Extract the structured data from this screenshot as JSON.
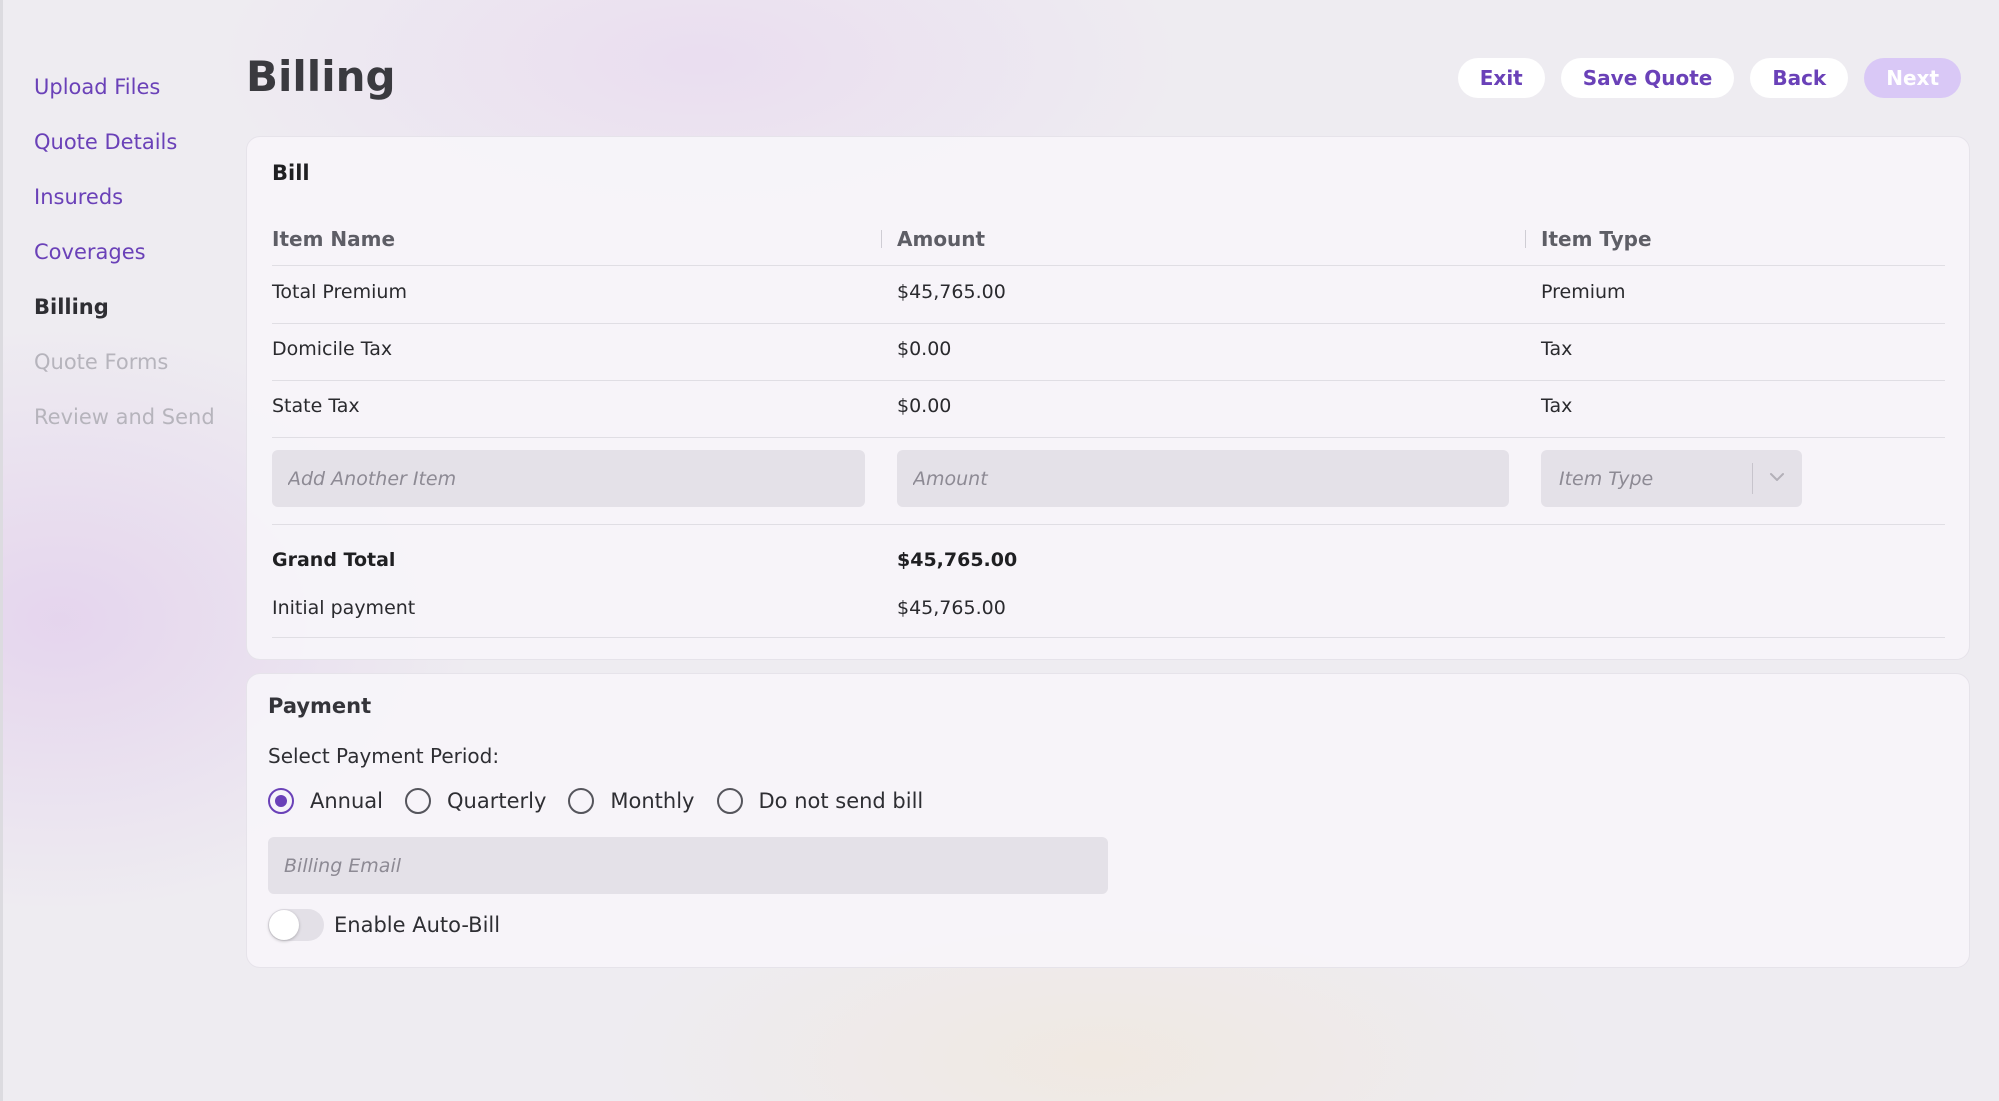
{
  "sidebar": {
    "items": [
      {
        "label": "Upload Files"
      },
      {
        "label": "Quote Details"
      },
      {
        "label": "Insureds"
      },
      {
        "label": "Coverages"
      },
      {
        "label": "Billing"
      },
      {
        "label": "Quote Forms"
      },
      {
        "label": "Review and Send"
      }
    ]
  },
  "header": {
    "title": "Billing",
    "exit_label": "Exit",
    "save_label": "Save Quote",
    "back_label": "Back",
    "next_label": "Next"
  },
  "bill": {
    "title": "Bill",
    "columns": [
      "Item Name",
      "Amount",
      "Item Type"
    ],
    "rows": [
      {
        "name": "Total Premium",
        "amount": "$45,765.00",
        "type": "Premium"
      },
      {
        "name": "Domicile Tax",
        "amount": "$0.00",
        "type": "Tax"
      },
      {
        "name": "State Tax",
        "amount": "$0.00",
        "type": "Tax"
      }
    ],
    "new_item": {
      "name_placeholder": "Add Another Item",
      "amount_placeholder": "Amount",
      "type_placeholder": "Item Type"
    },
    "grand_total_label": "Grand Total",
    "grand_total_value": "$45,765.00",
    "initial_payment_label": "Initial payment",
    "initial_payment_value": "$45,765.00"
  },
  "payment": {
    "title": "Payment",
    "period_label": "Select Payment Period:",
    "options": [
      "Annual",
      "Quarterly",
      "Monthly",
      "Do not send bill"
    ],
    "selected": "Annual",
    "email_placeholder": "Billing Email",
    "autobill_label": "Enable Auto-Bill",
    "autobill_enabled": false
  },
  "colors": {
    "accent": "#6a41b8",
    "accent_disabled": "#d9c8f6"
  },
  "icons": {
    "select_chevron": "chevron-down-icon"
  }
}
